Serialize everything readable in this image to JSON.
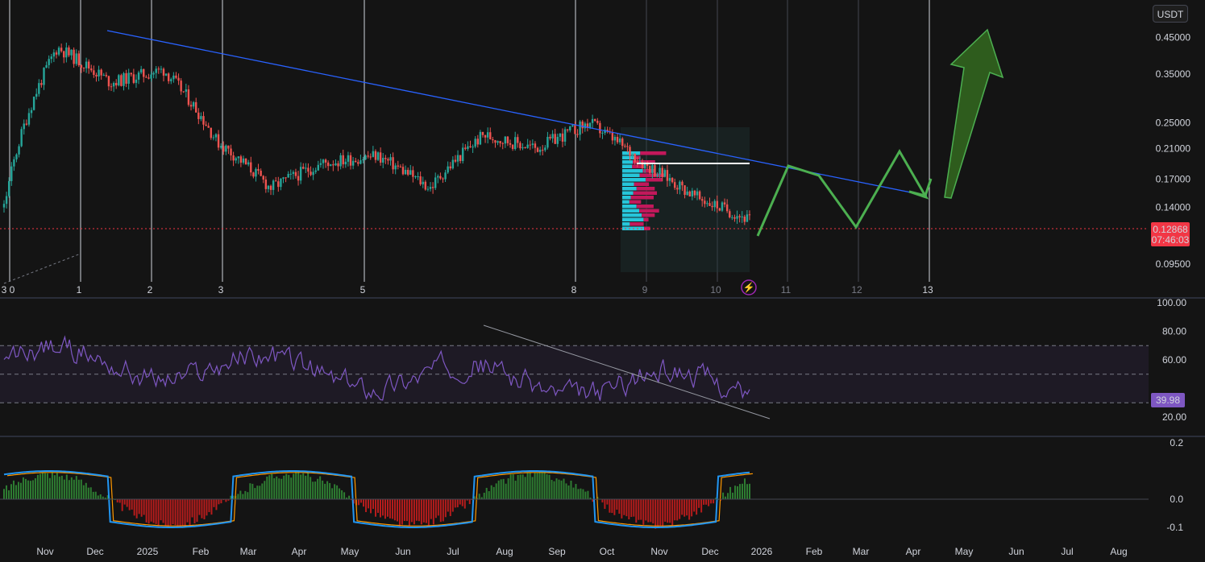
{
  "currency_button": "USDT",
  "price_label": "0.12868",
  "countdown_label": "07:46:03",
  "rsi_label": "39.98",
  "price_ticks": [
    "0.45000",
    "0.35000",
    "0.25000",
    "0.21000",
    "0.17000",
    "0.14000",
    "0.09500"
  ],
  "rsi_ticks": [
    "100.00",
    "80.00",
    "60.00",
    "20.00"
  ],
  "osc_ticks": [
    "0.2",
    "0.0",
    "-0.1"
  ],
  "cycle_labels": [
    "3 0",
    "1",
    "2",
    "3",
    "5",
    "8",
    "9",
    "10",
    "11",
    "12",
    "13"
  ],
  "time_labels": [
    "Nov",
    "Dec",
    "2025",
    "Feb",
    "Mar",
    "Apr",
    "May",
    "Jun",
    "Jul",
    "Aug",
    "Sep",
    "Oct",
    "Nov",
    "Dec",
    "2026",
    "Feb",
    "Mar",
    "Apr",
    "May",
    "Jun",
    "Jul",
    "Aug"
  ],
  "colors": {
    "background": "#141414",
    "candle_up": "#26a69a",
    "candle_down": "#ef5350",
    "trendline": "#2962ff",
    "projection": "#4caf50",
    "rsi_line": "#7e57c2",
    "osc_up": "#2e7d32",
    "osc_down": "#b71c1c",
    "fast_line": "#2196f3",
    "slow_line": "#ff9800",
    "price_badge": "#f23645",
    "rsi_badge": "#7e57c2"
  },
  "chart_data": [
    {
      "type": "candlestick",
      "title": "",
      "x": [
        "Nov 2024",
        "Dec 2024",
        "2025",
        "Feb",
        "Mar",
        "Apr",
        "May",
        "Jun",
        "Jul",
        "Aug",
        "Sep",
        "Oct",
        "Nov",
        "Dec",
        "2026"
      ],
      "close_approx": [
        0.14,
        0.42,
        0.33,
        0.36,
        0.22,
        0.16,
        0.19,
        0.2,
        0.16,
        0.23,
        0.21,
        0.25,
        0.19,
        0.15,
        0.12868
      ],
      "y_scale": "log",
      "ylim": [
        0.085,
        0.55
      ],
      "current_price": 0.12868,
      "trendline": {
        "start": {
          "x": "Dec 2024",
          "y": 0.47
        },
        "end": {
          "x": "Apr 2026",
          "y": 0.16
        }
      },
      "projection_path": [
        [
          0.125,
          0.2
        ],
        [
          0.21,
          0.2
        ],
        [
          0.205,
          0.135
        ],
        [
          0.215,
          0.135
        ],
        [
          0.16,
          0.2
        ],
        [
          0.17,
          0.2
        ]
      ]
    },
    {
      "type": "line",
      "title": "",
      "ylim": [
        20,
        100
      ],
      "bands": [
        30,
        50,
        70
      ],
      "last_value": 39.98
    },
    {
      "type": "bar",
      "title": "",
      "ylim": [
        -0.12,
        0.2
      ],
      "series": [
        {
          "values": []
        },
        {
          "values": []
        },
        {
          "values": []
        }
      ]
    }
  ]
}
